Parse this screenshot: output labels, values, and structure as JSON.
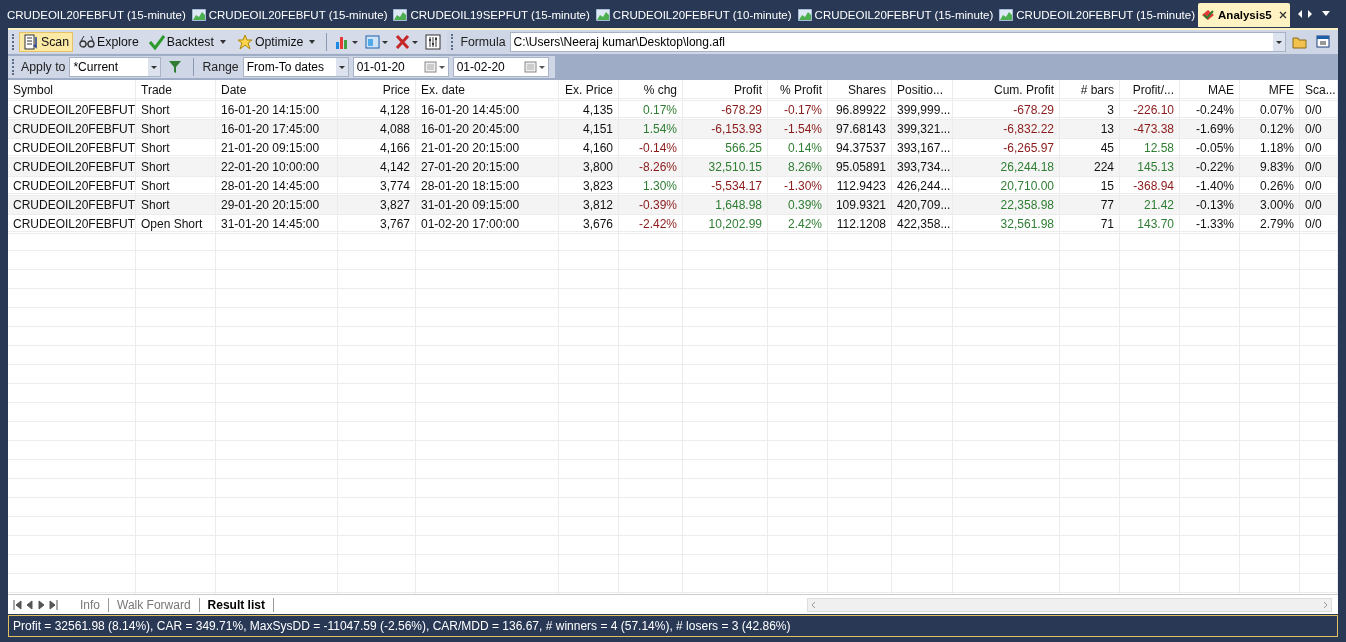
{
  "doc_tabs": [
    {
      "label": "CRUDEOIL20FEBFUT (15-minute)",
      "kind": "plain",
      "selected": false
    },
    {
      "label": "CRUDEOIL20FEBFUT (15-minute)",
      "kind": "chart",
      "selected": false
    },
    {
      "label": "CRUDEOIL19SEPFUT (15-minute)",
      "kind": "chart",
      "selected": false
    },
    {
      "label": "CRUDEOIL20FEBFUT (10-minute)",
      "kind": "chart",
      "selected": false
    },
    {
      "label": "CRUDEOIL20FEBFUT (15-minute)",
      "kind": "chart",
      "selected": false
    },
    {
      "label": "CRUDEOIL20FEBFUT (15-minute)",
      "kind": "chart",
      "selected": false
    },
    {
      "label": "Analysis5",
      "kind": "analysis",
      "selected": true
    }
  ],
  "toolbar": {
    "buttons": [
      {
        "label": "Scan",
        "kind": "scan",
        "selected": true
      },
      {
        "label": "Explore",
        "kind": "explore",
        "selected": false
      },
      {
        "label": "Backtest",
        "kind": "backtest",
        "selected": false
      },
      {
        "label": "Optimize",
        "kind": "optimize",
        "selected": false
      }
    ],
    "formula_label": "Formula",
    "formula_value": "C:\\Users\\Neeraj kumar\\Desktop\\long.afl"
  },
  "filter_bar": {
    "apply_label": "Apply to",
    "apply_value": "*Current",
    "range_label": "Range",
    "range_value": "From-To dates",
    "from_date": "01-01-20",
    "to_date": "01-02-20"
  },
  "table": {
    "columns": [
      "Symbol",
      "Trade",
      "Date",
      "Price",
      "Ex. date",
      "Ex. Price",
      "% chg",
      "Profit",
      "% Profit",
      "Shares",
      "Positio...",
      "Cum. Profit",
      "# bars",
      "Profit/...",
      "MAE",
      "MFE",
      "Sca..."
    ],
    "rows": [
      {
        "cells": [
          "CRUDEOIL20FEBFUT",
          "Short",
          "16-01-20 14:15:00",
          "4,128",
          "16-01-20 14:45:00",
          "4,135",
          {
            "text": "0.17%",
            "color": "#2e7d32"
          },
          {
            "text": "-678.29",
            "color": "#8b1a1a"
          },
          {
            "text": "-0.17%",
            "color": "#8b1a1a"
          },
          "96.89922",
          "399,999...",
          {
            "text": "-678.29",
            "color": "#8b1a1a"
          },
          "3",
          {
            "text": "-226.10",
            "color": "#8b1a1a"
          },
          "-0.24%",
          "0.07%",
          "0/0"
        ]
      },
      {
        "cells": [
          "CRUDEOIL20FEBFUT",
          "Short",
          "16-01-20 17:45:00",
          "4,088",
          "16-01-20 20:45:00",
          "4,151",
          {
            "text": "1.54%",
            "color": "#2e7d32"
          },
          {
            "text": "-6,153.93",
            "color": "#8b1a1a"
          },
          {
            "text": "-1.54%",
            "color": "#8b1a1a"
          },
          "97.68143",
          "399,321...",
          {
            "text": "-6,832.22",
            "color": "#8b1a1a"
          },
          "13",
          {
            "text": "-473.38",
            "color": "#8b1a1a"
          },
          "-1.69%",
          "0.12%",
          "0/0"
        ]
      },
      {
        "cells": [
          "CRUDEOIL20FEBFUT",
          "Short",
          "21-01-20 09:15:00",
          "4,166",
          "21-01-20 20:15:00",
          "4,160",
          {
            "text": "-0.14%",
            "color": "#8b1a1a"
          },
          {
            "text": "566.25",
            "color": "#2e7d32"
          },
          {
            "text": "0.14%",
            "color": "#2e7d32"
          },
          "94.37537",
          "393,167...",
          {
            "text": "-6,265.97",
            "color": "#8b1a1a"
          },
          "45",
          {
            "text": "12.58",
            "color": "#2e7d32"
          },
          "-0.05%",
          "1.18%",
          "0/0"
        ]
      },
      {
        "cells": [
          "CRUDEOIL20FEBFUT",
          "Short",
          "22-01-20 10:00:00",
          "4,142",
          "27-01-20 20:15:00",
          "3,800",
          {
            "text": "-8.26%",
            "color": "#8b1a1a"
          },
          {
            "text": "32,510.15",
            "color": "#2e7d32"
          },
          {
            "text": "8.26%",
            "color": "#2e7d32"
          },
          "95.05891",
          "393,734...",
          {
            "text": "26,244.18",
            "color": "#2e7d32"
          },
          "224",
          {
            "text": "145.13",
            "color": "#2e7d32"
          },
          "-0.22%",
          "9.83%",
          "0/0"
        ]
      },
      {
        "cells": [
          "CRUDEOIL20FEBFUT",
          "Short",
          "28-01-20 14:45:00",
          "3,774",
          "28-01-20 18:15:00",
          "3,823",
          {
            "text": "1.30%",
            "color": "#2e7d32"
          },
          {
            "text": "-5,534.17",
            "color": "#8b1a1a"
          },
          {
            "text": "-1.30%",
            "color": "#8b1a1a"
          },
          "112.9423",
          "426,244...",
          {
            "text": "20,710.00",
            "color": "#2e7d32"
          },
          "15",
          {
            "text": "-368.94",
            "color": "#8b1a1a"
          },
          "-1.40%",
          "0.26%",
          "0/0"
        ]
      },
      {
        "cells": [
          "CRUDEOIL20FEBFUT",
          "Short",
          "29-01-20 20:15:00",
          "3,827",
          "31-01-20 09:15:00",
          "3,812",
          {
            "text": "-0.39%",
            "color": "#8b1a1a"
          },
          {
            "text": "1,648.98",
            "color": "#2e7d32"
          },
          {
            "text": "0.39%",
            "color": "#2e7d32"
          },
          "109.9321",
          "420,709...",
          {
            "text": "22,358.98",
            "color": "#2e7d32"
          },
          "77",
          {
            "text": "21.42",
            "color": "#2e7d32"
          },
          "-0.13%",
          "3.00%",
          "0/0"
        ]
      },
      {
        "cells": [
          "CRUDEOIL20FEBFUT",
          "Open Short",
          "31-01-20 14:45:00",
          "3,767",
          "01-02-20 17:00:00",
          "3,676",
          {
            "text": "-2.42%",
            "color": "#8b1a1a"
          },
          {
            "text": "10,202.99",
            "color": "#2e7d32"
          },
          {
            "text": "2.42%",
            "color": "#2e7d32"
          },
          "112.1208",
          "422,358...",
          {
            "text": "32,561.98",
            "color": "#2e7d32"
          },
          "71",
          {
            "text": "143.70",
            "color": "#2e7d32"
          },
          "-1.33%",
          "2.79%",
          "0/0"
        ]
      }
    ]
  },
  "sheet_tabs": [
    {
      "label": "Info",
      "selected": false
    },
    {
      "label": "Walk Forward",
      "selected": false
    },
    {
      "label": "Result list",
      "selected": true
    }
  ],
  "status_bar": "Profit = 32561.98 (8.14%), CAR = 349.71%, MaxSysDD = -11047.59 (-2.56%), CAR/MDD = 136.67, # winners = 4 (57.14%), # losers = 3 (42.86%)"
}
